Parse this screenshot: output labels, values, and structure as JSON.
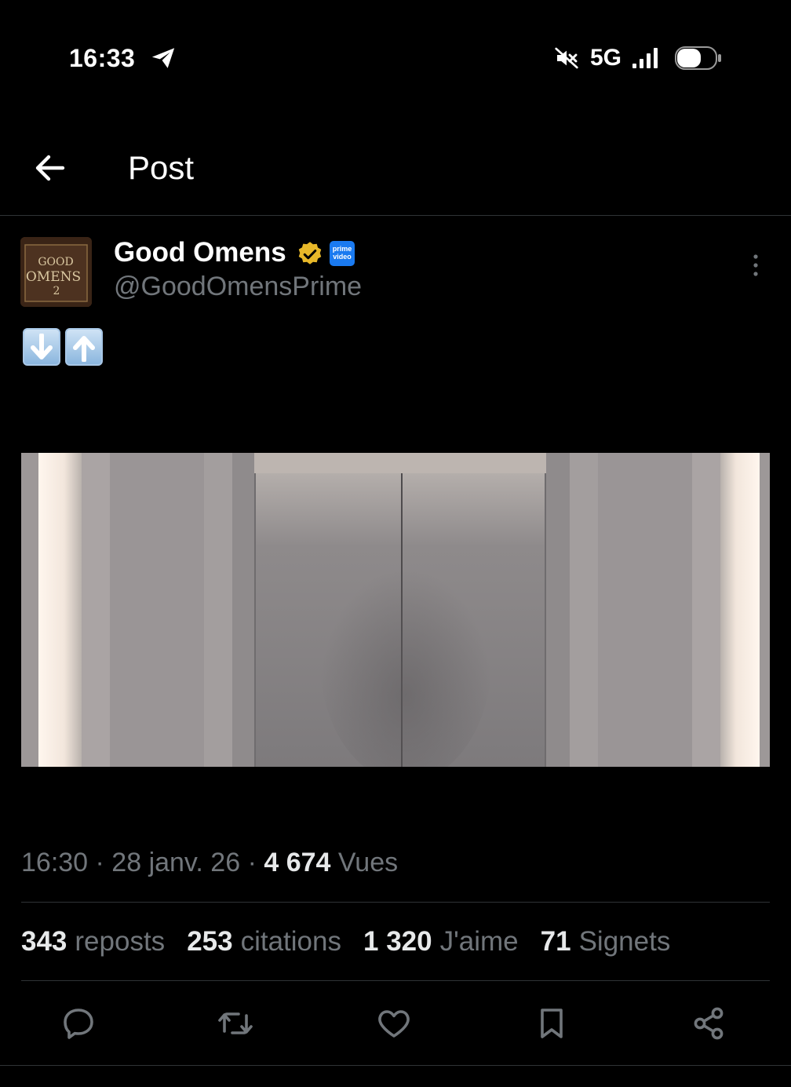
{
  "status_bar": {
    "time": "16:33",
    "network": "5G",
    "icons": [
      "telegram-send-icon",
      "mute-icon",
      "signal-icon",
      "battery-icon"
    ]
  },
  "header": {
    "back_icon": "arrow-left-icon",
    "title": "Post"
  },
  "post": {
    "author": {
      "name": "Good Omens",
      "handle": "@GoodOmensPrime",
      "badges": [
        "verified-badge-icon",
        "prime-video-icon"
      ],
      "prime_badge_text": "prime video",
      "avatar_text": "GOOD OMENS 2"
    },
    "text_emojis": [
      "down-arrow-emoji",
      "up-arrow-emoji"
    ],
    "media_description_icon": "elevator-doors-image",
    "timestamp": "16:30 · 28 janv. 26 · ",
    "views_count": "4 674",
    "views_label": " Vues"
  },
  "stats": [
    {
      "count": "343",
      "label": "reposts"
    },
    {
      "count": "253",
      "label": "citations"
    },
    {
      "count": "1 320",
      "label": "J'aime"
    },
    {
      "count": "71",
      "label": "Signets"
    }
  ],
  "actions": [
    "reply-icon",
    "repost-icon",
    "like-icon",
    "bookmark-icon",
    "share-icon"
  ],
  "colors": {
    "background": "#000000",
    "text_primary": "#e7e9ea",
    "text_secondary": "#71767b",
    "divider": "#2f3336",
    "verified_gold": "#e8b829",
    "prime_blue": "#1a7af0"
  }
}
